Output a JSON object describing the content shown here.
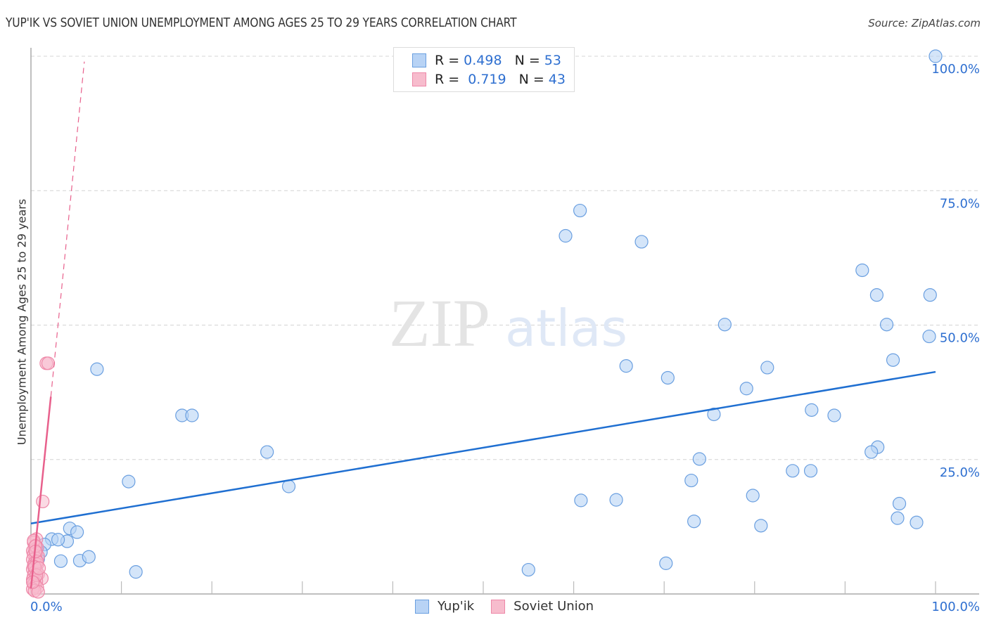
{
  "header": {
    "title": "YUP'IK VS SOVIET UNION UNEMPLOYMENT AMONG AGES 25 TO 29 YEARS CORRELATION CHART",
    "source": "Source: ZipAtlas.com"
  },
  "watermark": {
    "zip": "ZIP",
    "atlas": "atlas"
  },
  "legend_top": [
    {
      "r_label": "R = ",
      "r_value": "0.498",
      "n_label": "N = ",
      "n_value": "53"
    },
    {
      "r_label": "R = ",
      "r_value": " 0.719",
      "n_label": "N = ",
      "n_value": "43"
    }
  ],
  "legend_bottom": [
    {
      "label": "Yup'ik"
    },
    {
      "label": "Soviet Union"
    }
  ],
  "colors": {
    "yupik_fill": "#b8d3f5",
    "yupik_stroke": "#6a9fe0",
    "yupik_line": "#1f6fd1",
    "soviet_fill": "#f7bccd",
    "soviet_stroke": "#ee88a8",
    "soviet_line": "#e8608c",
    "axis_label": "#2e6fd0"
  },
  "chart_data": {
    "type": "scatter",
    "title": "YUP'IK VS SOVIET UNION UNEMPLOYMENT AMONG AGES 25 TO 29 YEARS CORRELATION CHART",
    "xlabel": "",
    "ylabel": "Unemployment Among Ages 25 to 29 years",
    "xlim": [
      0,
      100
    ],
    "ylim": [
      0,
      100
    ],
    "x_tick_labels": [
      "0.0%",
      "100.0%"
    ],
    "y_tick_labels": [
      "25.0%",
      "50.0%",
      "75.0%",
      "100.0%"
    ],
    "y_ticks": [
      25,
      50,
      75,
      100
    ],
    "x_minor_ticks": [
      10,
      20,
      30,
      40,
      50,
      60,
      70,
      80,
      90,
      100
    ],
    "grid": true,
    "legend": "top-center",
    "series": [
      {
        "name": "Yup'ik",
        "R": 0.498,
        "N": 53,
        "trend": {
          "x": [
            0,
            100
          ],
          "y": [
            13.1,
            41.3
          ],
          "style": "solid"
        },
        "points": [
          [
            100,
            100
          ],
          [
            59.1,
            66.6
          ],
          [
            67.5,
            65.5
          ],
          [
            60.7,
            71.3
          ],
          [
            91.9,
            60.2
          ],
          [
            93.5,
            55.6
          ],
          [
            99.4,
            55.6
          ],
          [
            76.7,
            50.1
          ],
          [
            94.6,
            50.1
          ],
          [
            99.3,
            47.9
          ],
          [
            95.3,
            43.5
          ],
          [
            65.8,
            42.4
          ],
          [
            81.4,
            42.1
          ],
          [
            70.4,
            40.2
          ],
          [
            79.1,
            38.2
          ],
          [
            86.3,
            34.2
          ],
          [
            88.8,
            33.2
          ],
          [
            75.5,
            33.4
          ],
          [
            93.6,
            27.3
          ],
          [
            92.9,
            26.4
          ],
          [
            73.9,
            25.1
          ],
          [
            84.2,
            22.9
          ],
          [
            86.2,
            22.9
          ],
          [
            73.0,
            21.1
          ],
          [
            79.8,
            18.3
          ],
          [
            60.8,
            17.4
          ],
          [
            64.7,
            17.5
          ],
          [
            96.0,
            16.8
          ],
          [
            73.3,
            13.5
          ],
          [
            80.7,
            12.7
          ],
          [
            95.8,
            14.1
          ],
          [
            97.9,
            13.3
          ],
          [
            55.0,
            4.5
          ],
          [
            70.2,
            5.7
          ],
          [
            7.3,
            41.8
          ],
          [
            16.7,
            33.2
          ],
          [
            17.8,
            33.2
          ],
          [
            26.1,
            26.4
          ],
          [
            10.8,
            20.9
          ],
          [
            28.5,
            20.0
          ],
          [
            4.3,
            12.2
          ],
          [
            5.1,
            11.5
          ],
          [
            4.0,
            9.8
          ],
          [
            2.3,
            10.2
          ],
          [
            3.0,
            10.1
          ],
          [
            1.5,
            9.2
          ],
          [
            1.1,
            7.8
          ],
          [
            0.8,
            6.5
          ],
          [
            3.3,
            6.1
          ],
          [
            5.4,
            6.2
          ],
          [
            6.4,
            6.9
          ],
          [
            11.6,
            4.1
          ],
          [
            0.6,
            8.4
          ]
        ]
      },
      {
        "name": "Soviet Union",
        "R": 0.719,
        "N": 43,
        "trend": {
          "x": [
            0,
            2.2
          ],
          "y": [
            1.0,
            36.7
          ],
          "style": "solid",
          "extended_dashed_to": [
            5.9,
            99.0
          ]
        },
        "points": [
          [
            1.7,
            42.9
          ],
          [
            1.9,
            42.9
          ],
          [
            1.3,
            17.2
          ],
          [
            0.6,
            10.2
          ],
          [
            0.3,
            9.6
          ],
          [
            0.5,
            9.0
          ],
          [
            0.7,
            8.6
          ],
          [
            0.4,
            8.2
          ],
          [
            0.2,
            8.0
          ],
          [
            0.6,
            7.6
          ],
          [
            0.3,
            7.3
          ],
          [
            0.8,
            7.0
          ],
          [
            0.5,
            6.7
          ],
          [
            0.2,
            6.4
          ],
          [
            0.6,
            6.1
          ],
          [
            0.4,
            5.8
          ],
          [
            0.7,
            5.5
          ],
          [
            0.3,
            5.2
          ],
          [
            0.5,
            4.9
          ],
          [
            0.2,
            4.6
          ],
          [
            0.6,
            4.3
          ],
          [
            0.4,
            4.0
          ],
          [
            0.8,
            3.7
          ],
          [
            0.3,
            3.4
          ],
          [
            0.5,
            3.1
          ],
          [
            1.2,
            2.9
          ],
          [
            0.2,
            2.7
          ],
          [
            0.6,
            2.4
          ],
          [
            0.4,
            2.1
          ],
          [
            0.3,
            1.8
          ],
          [
            0.5,
            1.5
          ],
          [
            0.7,
            1.2
          ],
          [
            0.2,
            0.9
          ],
          [
            0.4,
            0.6
          ],
          [
            0.8,
            0.4
          ],
          [
            0.3,
            9.9
          ],
          [
            0.5,
            8.9
          ],
          [
            0.7,
            6.0
          ],
          [
            0.4,
            5.0
          ],
          [
            0.6,
            3.5
          ],
          [
            0.2,
            2.2
          ],
          [
            0.9,
            4.8
          ],
          [
            0.5,
            7.9
          ]
        ]
      }
    ]
  }
}
